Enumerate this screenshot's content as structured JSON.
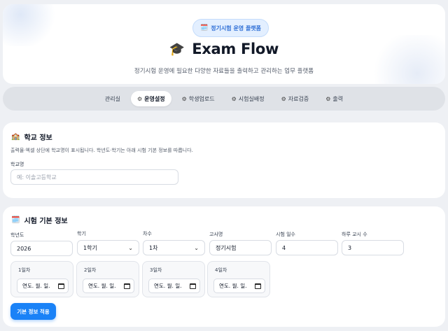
{
  "header": {
    "badge_icon": "🗓️",
    "badge_label": "정기시험 운영 플랫폼",
    "title_icon": "🎓",
    "title": "Exam Flow",
    "subtitle": "정기시험 운영에 필요한 다양한 자료들을 출력하고 관리하는 업무 플랫폼"
  },
  "nav": {
    "tabs": [
      {
        "label": "관리실",
        "icon": "",
        "active": false
      },
      {
        "label": "운영설정",
        "icon": "⚙",
        "active": true
      },
      {
        "label": "학생업로드",
        "icon": "⚙",
        "active": false
      },
      {
        "label": "시험실배정",
        "icon": "⚙",
        "active": false
      },
      {
        "label": "자료검증",
        "icon": "⚙",
        "active": false
      },
      {
        "label": "출력",
        "icon": "⚙",
        "active": false
      }
    ]
  },
  "school": {
    "icon": "🏫",
    "title": "학교 정보",
    "description": "출력물·엑셀 상단에 학교명이 표시됩니다. 학년도·학기는 아래 시험 기본 정보를 따릅니다.",
    "name_label": "학교명",
    "name_placeholder": "예: 이솔고등학교",
    "name_value": ""
  },
  "exam": {
    "icon": "🗓️",
    "title": "시험 기본 정보",
    "fields": {
      "year": {
        "label": "학년도",
        "value": "2026"
      },
      "semester": {
        "label": "학기",
        "value": "1학기"
      },
      "round": {
        "label": "차수",
        "value": "1차"
      },
      "exam_name": {
        "label": "고사명",
        "value": "정기시험"
      },
      "days": {
        "label": "시험 일수",
        "value": "4"
      },
      "periods": {
        "label": "하루 교시 수",
        "value": "3"
      }
    },
    "day_dates": [
      {
        "label": "1일차",
        "value": "연도. 월. 일."
      },
      {
        "label": "2일차",
        "value": "연도. 월. 일."
      },
      {
        "label": "3일차",
        "value": "연도. 월. 일."
      },
      {
        "label": "4일차",
        "value": "연도. 월. 일."
      }
    ],
    "apply_label": "기본 정보 적용"
  }
}
